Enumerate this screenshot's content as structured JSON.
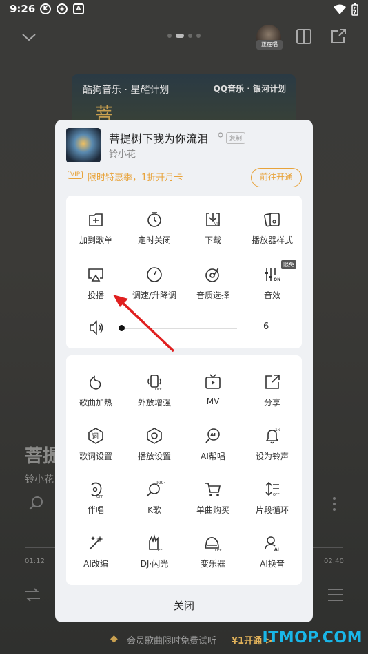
{
  "status": {
    "time": "9:26",
    "left_icons": [
      "K",
      "◈",
      "A"
    ]
  },
  "background": {
    "now_playing_badge": "正在唱",
    "album": {
      "brand_kugou": "酷狗音乐 · 星耀计划",
      "brand_qq": "QQ音乐 · 银河计划",
      "glyph": "菩"
    },
    "title_partial": "菩提",
    "artist_partial": "铃小花",
    "time_elapsed": "01:12",
    "time_total": "02:40"
  },
  "sheet": {
    "song_title": "菩提树下我为你流泪",
    "copy_label": "复制",
    "artist": "铃小花",
    "vip": {
      "tag": "VIP",
      "text": "限时特惠季，1折开月卡",
      "button": "前往开通"
    },
    "panel1": [
      {
        "label": "加到歌单",
        "icon": "add-playlist-icon"
      },
      {
        "label": "定时关闭",
        "icon": "timer-icon"
      },
      {
        "label": "下载",
        "icon": "download-vip-icon"
      },
      {
        "label": "播放器样式",
        "icon": "player-style-icon"
      },
      {
        "label": "投播",
        "icon": "cast-icon"
      },
      {
        "label": "调速/升降调",
        "icon": "speed-icon"
      },
      {
        "label": "音质选择",
        "icon": "quality-icon"
      },
      {
        "label": "音效",
        "icon": "sound-effect-icon",
        "badge": "限免"
      }
    ],
    "volume": {
      "value": "6",
      "level": 0.0
    },
    "panel2": [
      {
        "label": "歌曲加热",
        "icon": "heat-icon"
      },
      {
        "label": "外放增强",
        "icon": "speaker-boost-icon"
      },
      {
        "label": "MV",
        "icon": "mv-icon"
      },
      {
        "label": "分享",
        "icon": "share-icon"
      },
      {
        "label": "歌词设置",
        "icon": "lyrics-settings-icon"
      },
      {
        "label": "播放设置",
        "icon": "play-settings-icon"
      },
      {
        "label": "AI帮唱",
        "icon": "ai-sing-icon"
      },
      {
        "label": "设为铃声",
        "icon": "ringtone-icon"
      },
      {
        "label": "伴唱",
        "icon": "accompaniment-icon"
      },
      {
        "label": "K歌",
        "icon": "karaoke-icon"
      },
      {
        "label": "单曲购买",
        "icon": "cart-icon"
      },
      {
        "label": "片段循环",
        "icon": "loop-segment-icon"
      },
      {
        "label": "AI改编",
        "icon": "ai-adapt-icon"
      },
      {
        "label": "DJ·闪光",
        "icon": "dj-flash-icon"
      },
      {
        "label": "变乐器",
        "icon": "instrument-icon"
      },
      {
        "label": "AI换音",
        "icon": "ai-voice-icon"
      }
    ],
    "close_label": "关闭"
  },
  "banner": {
    "text": "会员歌曲限时免费试听",
    "open_label": "¥1开通 >"
  },
  "watermark": "ITMOP.COM",
  "colors": {
    "accent": "#e8a33a",
    "arrow": "#e02020",
    "watermark": "#19b6e8"
  }
}
